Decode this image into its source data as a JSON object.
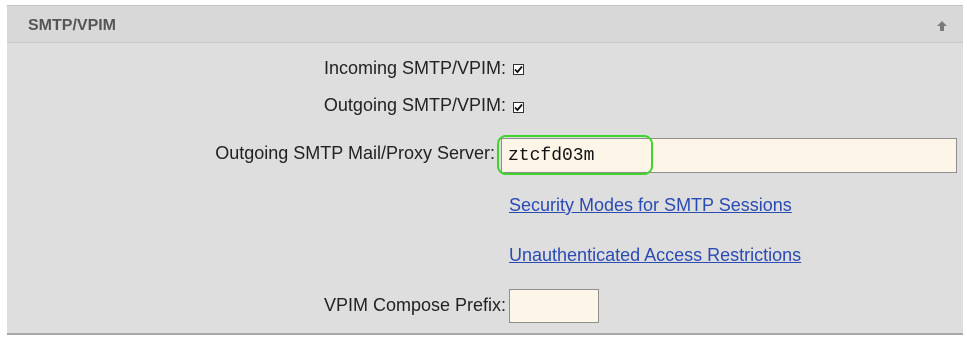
{
  "section": {
    "title": "SMTP/VPIM",
    "collapse_icon": "up-arrow-icon"
  },
  "fields": {
    "incoming": {
      "label": "Incoming SMTP/VPIM:",
      "checked": true
    },
    "outgoing": {
      "label": "Outgoing SMTP/VPIM:",
      "checked": true
    },
    "proxy_server": {
      "label": "Outgoing SMTP Mail/Proxy Server:",
      "value": "ztcfd03m"
    },
    "vpim_prefix": {
      "label": "VPIM Compose Prefix:",
      "value": ""
    }
  },
  "links": {
    "security_modes": "Security Modes for SMTP Sessions",
    "unauth_restrictions": "Unauthenticated Access Restrictions"
  },
  "colors": {
    "highlight": "#3ed62c",
    "link": "#2a4bb2",
    "input_bg": "#fdf6e8"
  }
}
